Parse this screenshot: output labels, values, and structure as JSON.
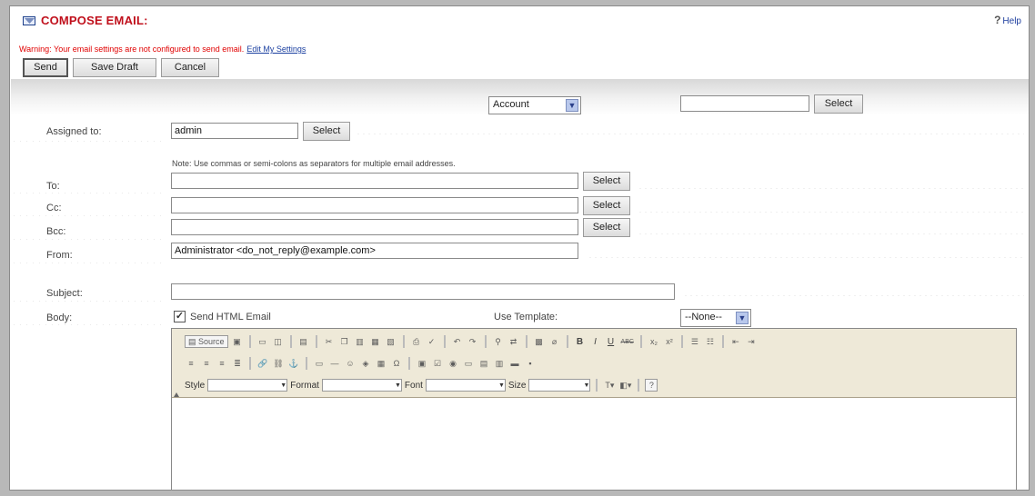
{
  "header": {
    "title": "COMPOSE EMAIL:",
    "help_q": "?",
    "help_label": "Help"
  },
  "warning": {
    "text": "Warning: Your email settings are not configured to send email.",
    "link": "Edit My Settings"
  },
  "actions": {
    "send": "Send",
    "save_draft": "Save Draft",
    "cancel": "Cancel"
  },
  "parent": {
    "type_selected": "Account",
    "name_value": "",
    "select_label": "Select"
  },
  "form": {
    "assigned_to": {
      "label": "Assigned to:",
      "value": "admin",
      "select_label": "Select"
    },
    "note": "Note: Use commas or semi-colons as separators for multiple email addresses.",
    "to": {
      "label": "To:",
      "value": "",
      "select_label": "Select"
    },
    "cc": {
      "label": "Cc:",
      "value": "",
      "select_label": "Select"
    },
    "bcc": {
      "label": "Bcc:",
      "value": "",
      "select_label": "Select"
    },
    "from": {
      "label": "From:",
      "value": "Administrator <do_not_reply@example.com>"
    },
    "subject": {
      "label": "Subject:",
      "value": ""
    },
    "body": {
      "label": "Body:",
      "send_html_checked": true,
      "send_html_label": "Send HTML Email",
      "use_template_label": "Use Template:",
      "template_selected": "--None--"
    }
  },
  "editor": {
    "source_label": "Source",
    "style_label": "Style",
    "format_label": "Format",
    "font_label": "Font",
    "size_label": "Size",
    "help_label": "?",
    "bold_label": "B",
    "italic_label": "I",
    "underline_label": "U",
    "strike_label": "ABC",
    "subscript_label": "x₂",
    "superscript_label": "x²"
  },
  "colors": {
    "title_red": "#c0101c",
    "warning_red": "#e00000",
    "link_blue": "#1a3fa0",
    "toolbar_bg": "#eee9d8"
  }
}
